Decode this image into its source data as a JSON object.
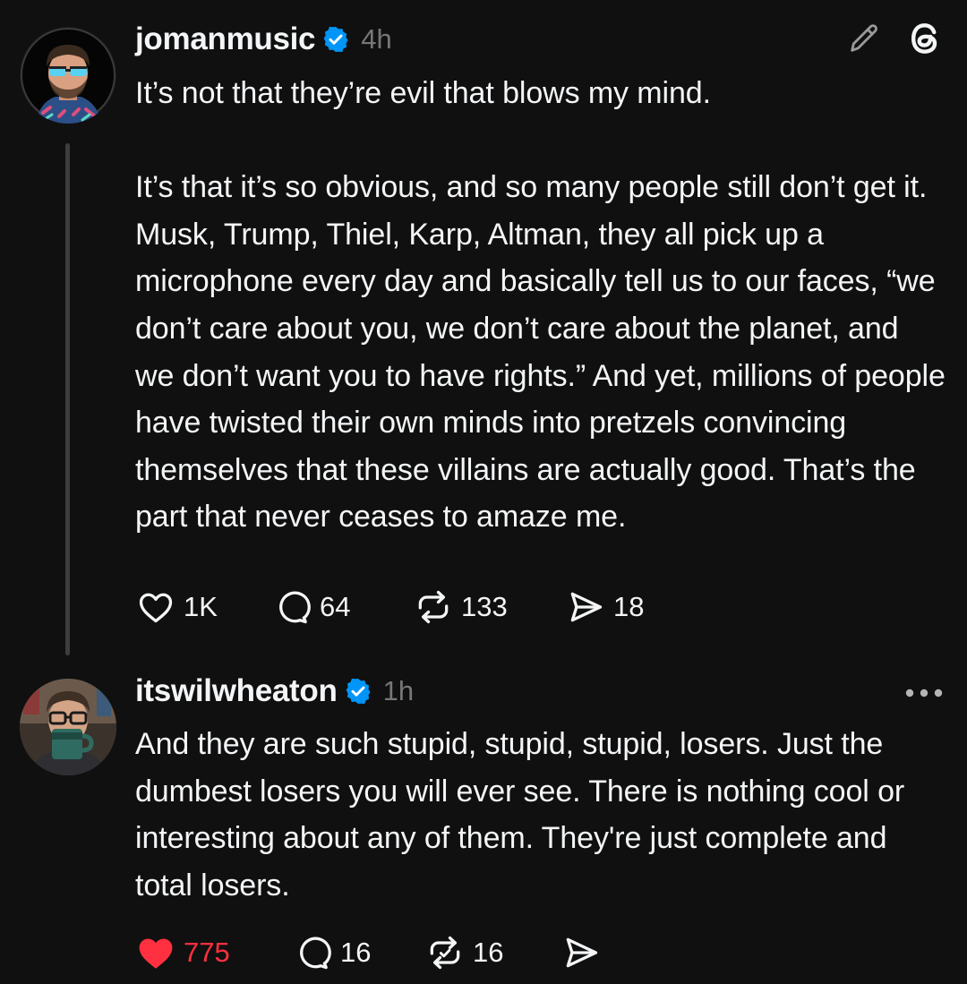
{
  "posts": [
    {
      "username": "jomanmusic",
      "verified": true,
      "time": "4h",
      "avatar_icon": "avatar-sunglasses-man",
      "text": "It’s not that they’re evil that blows my mind.\n\nIt’s that it’s so obvious, and so many people still don’t get it. Musk, Trump, Thiel, Karp, Altman, they all pick up a microphone every day and basically tell us to our faces, “we don’t care about you, we don’t care about the planet, and we don’t want you to have rights.” And yet, millions of people have twisted their own minds into pretzels convincing themselves that these villains are actually good. That’s the part that never ceases to amaze me.",
      "likes": "1K",
      "replies": "64",
      "reposts": "133",
      "shares": "18",
      "liked": false,
      "top_icons": [
        "pencil-icon",
        "threads-logo-icon"
      ]
    },
    {
      "username": "itswilwheaton",
      "verified": true,
      "time": "1h",
      "avatar_icon": "avatar-man-with-mug",
      "text": "And they are such stupid, stupid, stupid, losers. Just the dumbest losers you will ever see. There is nothing cool or interesting about any of them. They're just complete and total losers.",
      "likes": "775",
      "replies": "16",
      "reposts": "16",
      "shares": "",
      "liked": true,
      "more_icon": "more-horizontal-icon"
    }
  ],
  "colors": {
    "background": "#101010",
    "text_primary": "#f3f5f7",
    "text_secondary": "#777777",
    "verified_blue": "#0095f6",
    "like_red": "#ff3040",
    "thread_line": "#3d3d3d"
  }
}
